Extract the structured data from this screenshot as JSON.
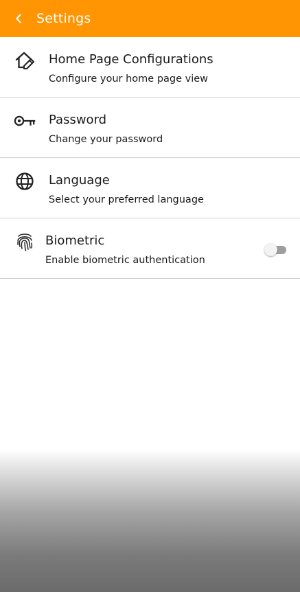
{
  "appbar": {
    "title": "Settings",
    "color": "#ff9502"
  },
  "items": [
    {
      "icon": "home-edit-icon",
      "title": "Home Page Configurations",
      "subtitle": "Configure your home page view"
    },
    {
      "icon": "key-icon",
      "title": "Password",
      "subtitle": "Change your password"
    },
    {
      "icon": "globe-icon",
      "title": "Language",
      "subtitle": "Select your preferred language"
    },
    {
      "icon": "fingerprint-icon",
      "title": "Biometric",
      "subtitle": "Enable biometric authentication",
      "toggle_on": false
    }
  ]
}
